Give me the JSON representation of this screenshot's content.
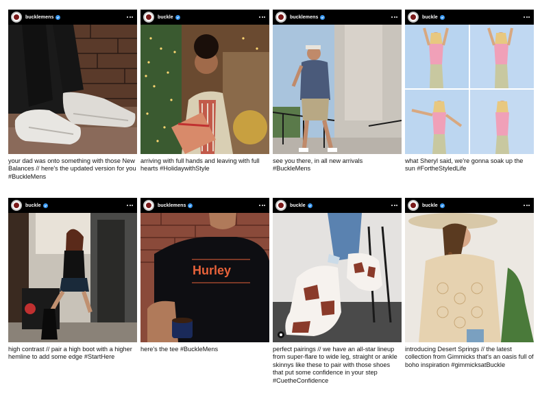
{
  "posts": [
    {
      "username": "bucklemens",
      "caption": "your dad was onto something with those New Balances // here's the updated version for you #BuckleMens"
    },
    {
      "username": "buckle",
      "caption": "arriving with full hands and leaving with full hearts #HolidaywithStyle"
    },
    {
      "username": "bucklemens",
      "caption": "see you there, in all new arrivals #BuckleMens"
    },
    {
      "username": "buckle",
      "caption": "what Sheryl said, we're gonna soak up the sun #FortheStyledLife"
    },
    {
      "username": "buckle",
      "caption": "high contrast // pair a high boot with a higher hemline to add some edge #StartHere"
    },
    {
      "username": "bucklemens",
      "caption": "here's the tee #BuckleMens",
      "shirt_logo": "Hurley"
    },
    {
      "username": "buckle",
      "caption": "perfect pairings // we have an all-star lineup from super-flare to wide leg, straight or ankle skinnys like these to pair with those shoes that put some confidence in your step #CuetheConfidence"
    },
    {
      "username": "buckle",
      "caption": "introducing Desert Springs // the latest collection from Gimmicks that's an oasis full of boho inspiration #gimmicksatBuckle"
    }
  ],
  "colors": {
    "header_bg": "#000000",
    "verified": "#3897f0",
    "caption_text": "#111111"
  }
}
